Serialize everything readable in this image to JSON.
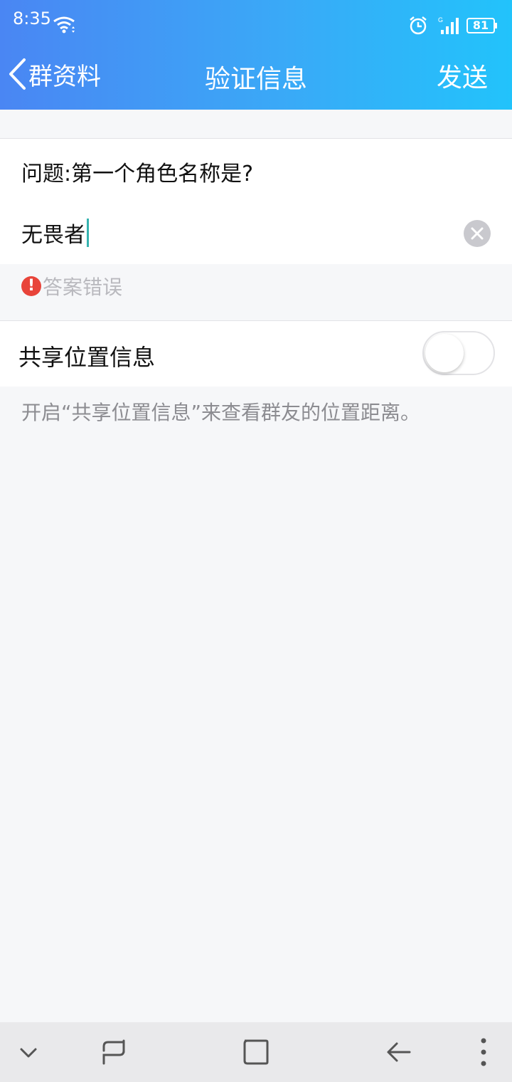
{
  "status": {
    "time": "8:35",
    "signal_label": "G",
    "battery": "81"
  },
  "header": {
    "back_label": "群资料",
    "title": "验证信息",
    "send_label": "发送"
  },
  "form": {
    "question": "问题:第一个角色名称是?",
    "answer_value": "无畏者",
    "error_icon_text": "!",
    "error_text": "答案错误"
  },
  "location": {
    "label": "共享位置信息",
    "toggle_on": false,
    "hint": "开启“共享位置信息”来查看群友的位置距离。"
  },
  "colors": {
    "header_start": "#4a86f3",
    "header_end": "#22c3fb",
    "error": "#e8443a",
    "caret": "#36b3b0",
    "background": "#f6f7f9"
  },
  "icons": [
    "wifi-icon",
    "alarm-icon",
    "signal-icon",
    "battery-icon",
    "back-icon",
    "clear-icon",
    "error-icon",
    "nav-down-icon",
    "nav-recent-icon",
    "nav-home-icon",
    "nav-back-icon",
    "nav-menu-icon"
  ]
}
